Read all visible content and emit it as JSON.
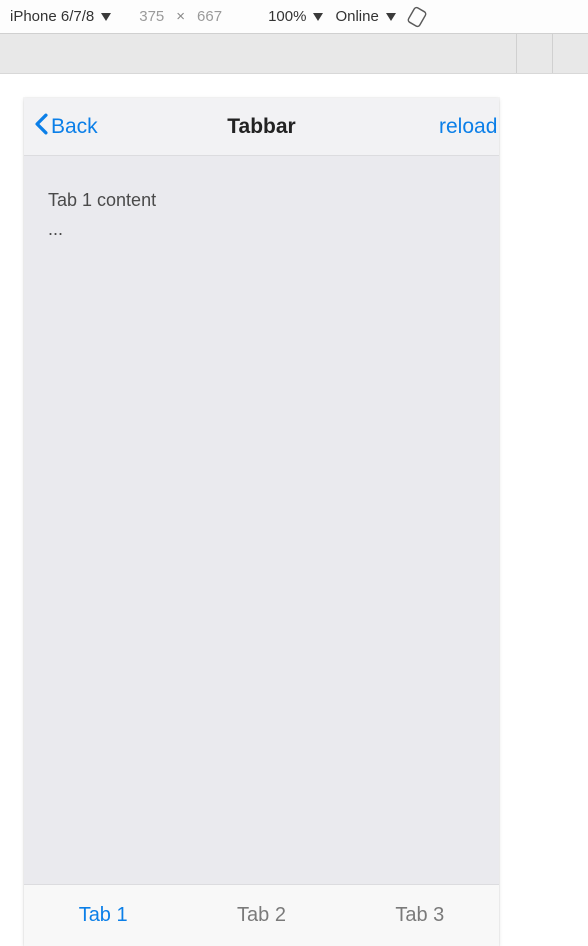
{
  "devtools": {
    "device": "iPhone 6/7/8",
    "width": "375",
    "height": "667",
    "dim_sep": "×",
    "zoom": "100%",
    "network": "Online"
  },
  "nav": {
    "back_label": "Back",
    "title": "Tabbar",
    "right_action": "reload"
  },
  "content": {
    "line1": "Tab 1 content",
    "line2": "..."
  },
  "tabs": {
    "tab1": "Tab 1",
    "tab2": "Tab 2",
    "tab3": "Tab 3",
    "active_index": 0
  }
}
